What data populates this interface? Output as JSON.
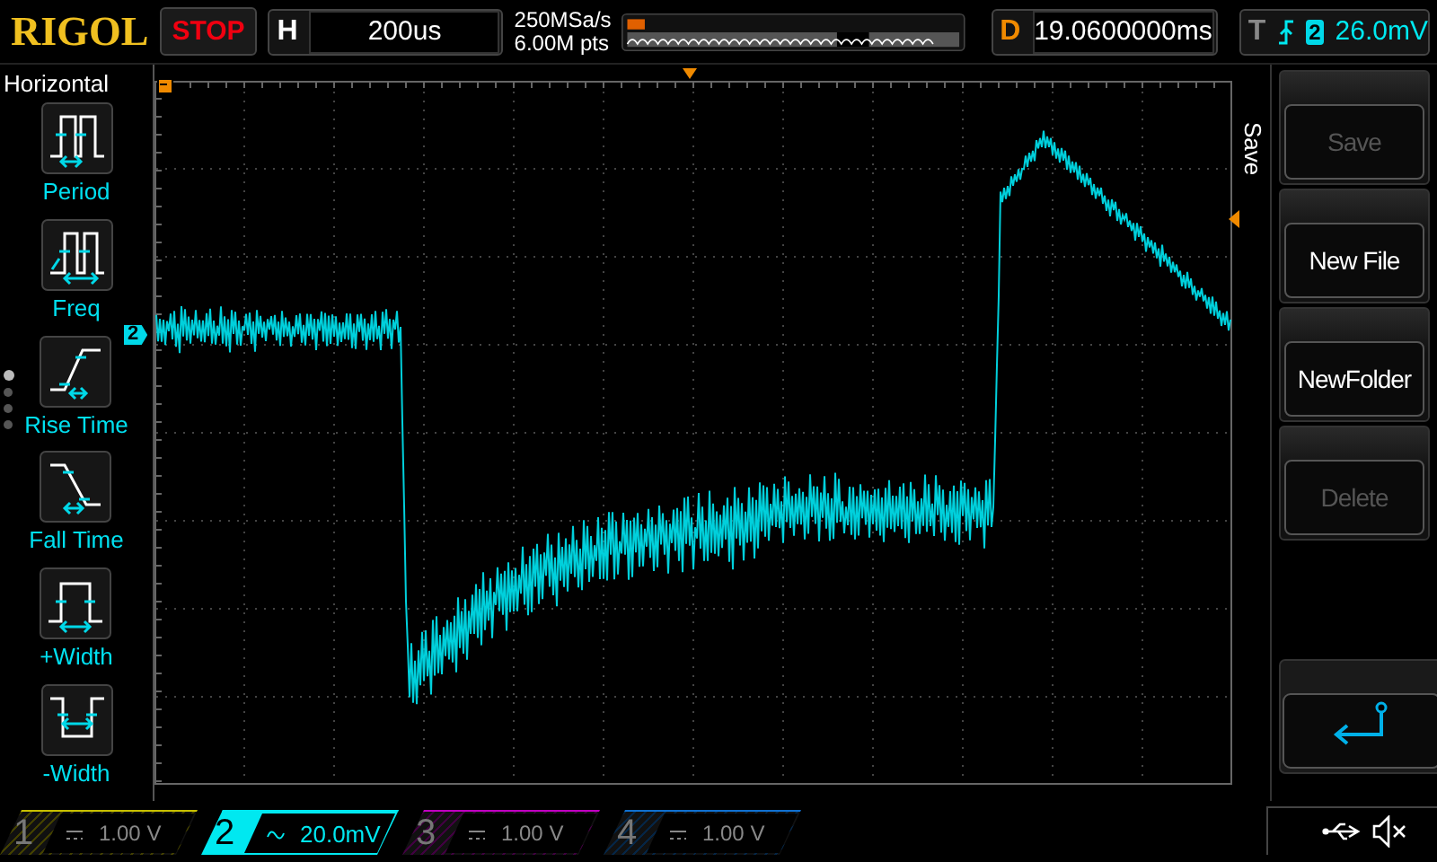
{
  "brand": "RIGOL",
  "run_state": {
    "label": "STOP",
    "kind": "stop"
  },
  "horizontal": {
    "label": "H",
    "value": "200us"
  },
  "acquisition": {
    "sample_rate": "250MSa/s",
    "memory_depth": "6.00M pts"
  },
  "delay": {
    "label": "D",
    "value": "19.0600000ms"
  },
  "trigger": {
    "label": "T",
    "channel": "2",
    "level": "26.0mV"
  },
  "measure_panel": {
    "title": "Horizontal",
    "items": [
      {
        "label": "Period",
        "kind": "period"
      },
      {
        "label": "Freq",
        "kind": "freq"
      },
      {
        "label": "Rise Time",
        "kind": "rise"
      },
      {
        "label": "Fall Time",
        "kind": "fall"
      },
      {
        "label": "+Width",
        "kind": "pwidth"
      },
      {
        "label": "-Width",
        "kind": "nwidth"
      }
    ],
    "pages": [
      {
        "selected": true
      },
      {
        "selected": false
      },
      {
        "selected": false
      },
      {
        "selected": false
      }
    ]
  },
  "waveform": {
    "channel_marker": "2"
  },
  "side_menu": {
    "title": "Save",
    "buttons": [
      {
        "label": "Save",
        "disabled": true
      },
      {
        "label": "New File",
        "disabled": false
      },
      {
        "label": "NewFolder",
        "disabled": false
      },
      {
        "label": "Delete",
        "disabled": true
      }
    ]
  },
  "channels": [
    {
      "number": "1",
      "kind": "dc",
      "scale": "1.00 V",
      "on": false,
      "color": "#c8c000"
    },
    {
      "number": "2",
      "kind": "ac",
      "scale": "20.0mV",
      "on": true,
      "color": "#00e8f0"
    },
    {
      "number": "3",
      "kind": "dc",
      "scale": "1.00 V",
      "on": false,
      "color": "#c000c0"
    },
    {
      "number": "4",
      "kind": "dc",
      "scale": "1.00 V",
      "on": false,
      "color": "#1070d0"
    }
  ]
}
